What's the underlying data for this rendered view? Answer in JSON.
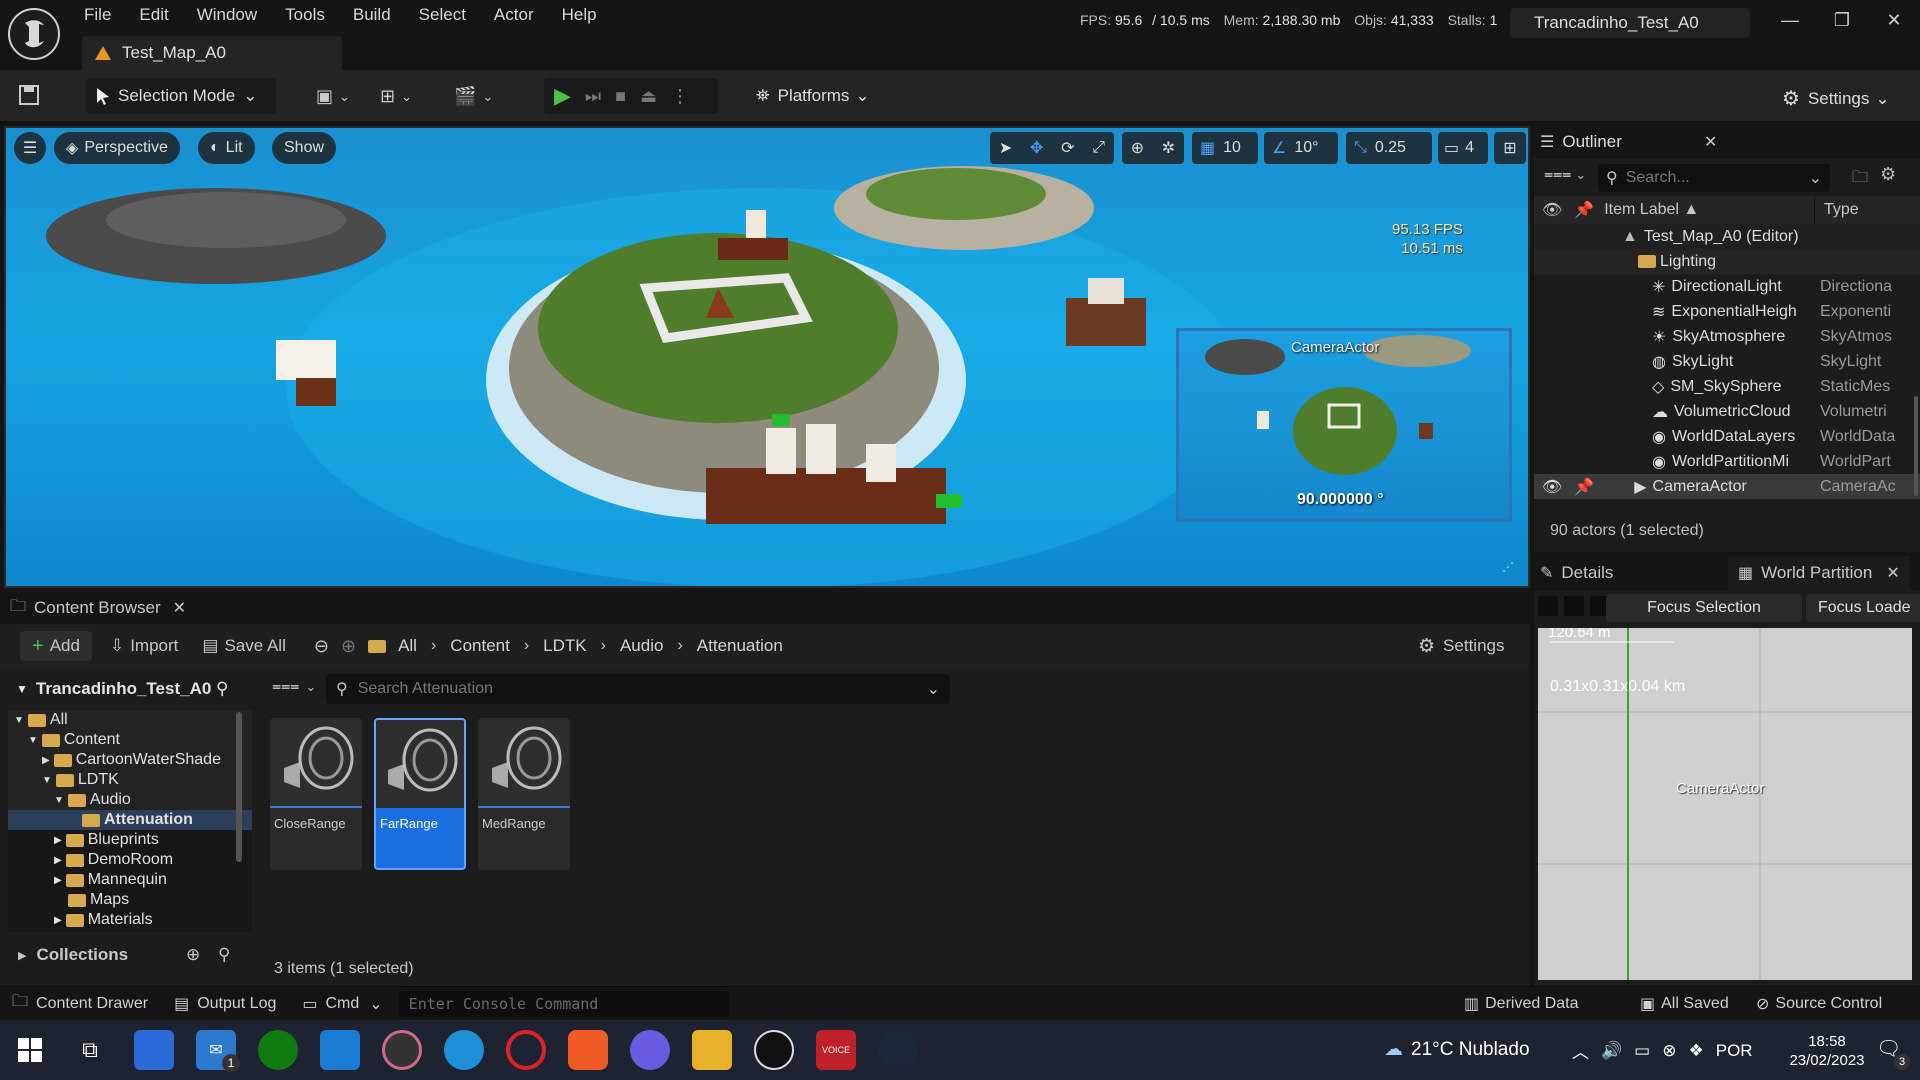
{
  "menu": [
    "File",
    "Edit",
    "Window",
    "Tools",
    "Build",
    "Select",
    "Actor",
    "Help"
  ],
  "map_tab": "Test_Map_A0",
  "stats": {
    "fps_label": "FPS:",
    "fps": "95.6",
    "ms": "/ 10.5 ms",
    "mem_label": "Mem:",
    "mem": "2,188.30 mb",
    "objs_label": "Objs:",
    "objs": "41,333",
    "stalls_label": "Stalls:",
    "stalls": "1"
  },
  "project_title": "Trancadinho_Test_A0",
  "toolbar": {
    "selection_mode": "Selection Mode",
    "platforms": "Platforms",
    "settings": "Settings"
  },
  "viewport": {
    "perspective": "Perspective",
    "lit": "Lit",
    "show": "Show",
    "grid_snap": "10",
    "rot_snap": "10°",
    "scale_snap": "0.25",
    "cam_speed": "4",
    "fps": "95.13 FPS",
    "ms": "10.51 ms",
    "preview_label": "CameraActor",
    "preview_fov": "90.000000 °"
  },
  "outliner": {
    "tab": "Outliner",
    "search_placeholder": "Search...",
    "col_label": "Item Label ▲",
    "col_type": "Type",
    "items": [
      {
        "label": "Test_Map_A0 (Editor)",
        "type": ""
      },
      {
        "label": "Lighting",
        "type": ""
      },
      {
        "label": "DirectionalLight",
        "type": "Directiona"
      },
      {
        "label": "ExponentialHeigh",
        "type": "Exponenti"
      },
      {
        "label": "SkyAtmosphere",
        "type": "SkyAtmos"
      },
      {
        "label": "SkyLight",
        "type": "SkyLight"
      },
      {
        "label": "SM_SkySphere",
        "type": "StaticMes"
      },
      {
        "label": "VolumetricCloud",
        "type": "Volumetri"
      },
      {
        "label": "WorldDataLayers",
        "type": "WorldData"
      },
      {
        "label": "WorldPartitionMi",
        "type": "WorldPart"
      },
      {
        "label": "CameraActor",
        "type": "CameraAc"
      }
    ],
    "footer": "90 actors (1 selected)"
  },
  "details": {
    "tab_details": "Details",
    "tab_wp": "World Partition",
    "focus_selection": "Focus Selection",
    "focus_loaded": "Focus Loade",
    "scale": "120.64 m",
    "size": "0.31x0.31x0.04 km",
    "camera_label": "CameraActor"
  },
  "content_browser": {
    "tab": "Content Browser",
    "add": "Add",
    "import": "Import",
    "save_all": "Save All",
    "crumbs": [
      "All",
      "Content",
      "LDTK",
      "Audio",
      "Attenuation"
    ],
    "settings": "Settings",
    "project": "Trancadinho_Test_A0",
    "search_placeholder": "Search Attenuation",
    "tree": [
      {
        "label": "All",
        "indent": 0
      },
      {
        "label": "Content",
        "indent": 1
      },
      {
        "label": "CartoonWaterShade",
        "indent": 2
      },
      {
        "label": "LDTK",
        "indent": 2
      },
      {
        "label": "Audio",
        "indent": 3
      },
      {
        "label": "Attenuation",
        "indent": 4
      },
      {
        "label": "Blueprints",
        "indent": 3
      },
      {
        "label": "DemoRoom",
        "indent": 3
      },
      {
        "label": "Mannequin",
        "indent": 3
      },
      {
        "label": "Maps",
        "indent": 3
      },
      {
        "label": "Materials",
        "indent": 3
      }
    ],
    "collections": "Collections",
    "assets": [
      "CloseRange",
      "FarRange",
      "MedRange"
    ],
    "footer": "3 items (1 selected)"
  },
  "statusbar": {
    "content_drawer": "Content Drawer",
    "output_log": "Output Log",
    "cmd": "Cmd",
    "console_placeholder": "Enter Console Command",
    "derived_data": "Derived Data",
    "all_saved": "All Saved",
    "source_control": "Source Control"
  },
  "taskbar": {
    "weather": "21°C  Nublado",
    "lang": "POR",
    "time": "18:58",
    "date": "23/02/2023",
    "notif_count": "3",
    "mail_badge": "1"
  }
}
